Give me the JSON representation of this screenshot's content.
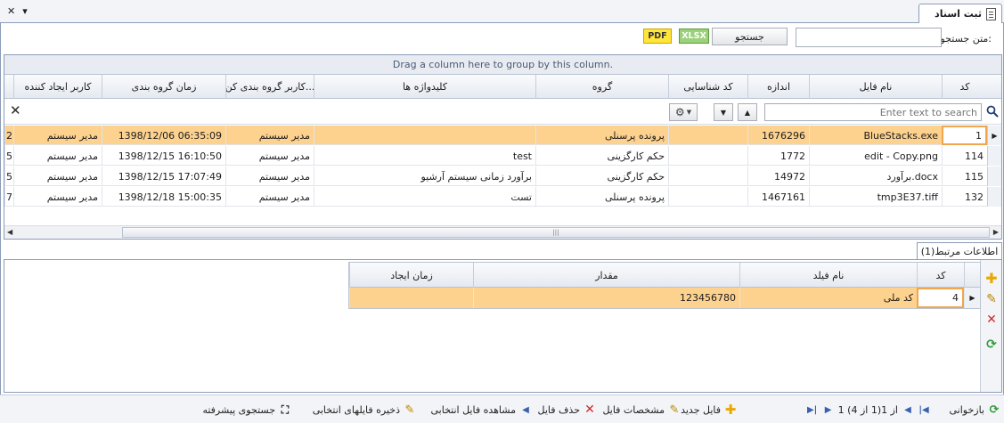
{
  "window": {
    "title": "ثبت اسناد",
    "close_glyph": "✕",
    "menu_glyph": "▾"
  },
  "search": {
    "label": "متن جستجو:",
    "value": "",
    "button": "جستجو",
    "xlsx": "XLSX",
    "pdf": "PDF"
  },
  "grid": {
    "group_hint": "Drag a column here to group by this column.",
    "columns": [
      "کد",
      "نام فایل",
      "اندازه",
      "کد شناسایی",
      "گروه",
      "کلیدواژه ها",
      "کاربر گروه بندی کن...",
      "زمان گروه بندی",
      "کاربر ایجاد کننده"
    ],
    "search_placeholder": "Enter text to search",
    "rows": [
      {
        "code": "1",
        "filename": "BlueStacks.exe",
        "size": "1676296",
        "ident": "",
        "group": "پرونده پرسنلی",
        "keywords": "",
        "group_user": "مدیر سیستم",
        "group_time": "1398/12/06 06:35:09",
        "creator": "مدیر سیستم",
        "edge": "2"
      },
      {
        "code": "114",
        "filename": "edit - Copy.png",
        "size": "1772",
        "ident": "",
        "group": "حکم کارگزینی",
        "keywords": "test",
        "group_user": "مدیر سیستم",
        "group_time": "1398/12/15 16:10:50",
        "creator": "مدیر سیستم",
        "edge": "5"
      },
      {
        "code": "115",
        "filename": "برآورد.docx",
        "size": "14972",
        "ident": "",
        "group": "حکم کارگزینی",
        "keywords": "برآورد زمانی سیستم آرشیو",
        "group_user": "مدیر سیستم",
        "group_time": "1398/12/15 17:07:49",
        "creator": "مدیر سیستم",
        "edge": "5"
      },
      {
        "code": "132",
        "filename": "tmp3E37.tiff",
        "size": "1467161",
        "ident": "",
        "group": "پرونده پرسنلی",
        "keywords": "تست",
        "group_user": "مدیر سیستم",
        "group_time": "1398/12/18 15:00:35",
        "creator": "مدیر سیستم",
        "edge": "7"
      }
    ]
  },
  "related": {
    "tab_label": "اطلاعات مرتبط(1)",
    "columns": [
      "کد",
      "نام فیلد",
      "مقدار",
      "زمان ایجاد"
    ],
    "rows": [
      {
        "code": "4",
        "field": "کد ملی",
        "value": "123456780",
        "created": ""
      }
    ]
  },
  "toolbar": {
    "reload": "بازخوانی",
    "pager": "1 از 1(1 از 4)",
    "new_file": "فایل جدید",
    "file_props": "مشخصات فایل",
    "delete_file": "حذف فایل",
    "view_selected": "مشاهده فایل انتخابی",
    "save_selected": "ذخیره فایلهای انتخابی",
    "advanced_search": "جستجوی پیشرفته"
  }
}
